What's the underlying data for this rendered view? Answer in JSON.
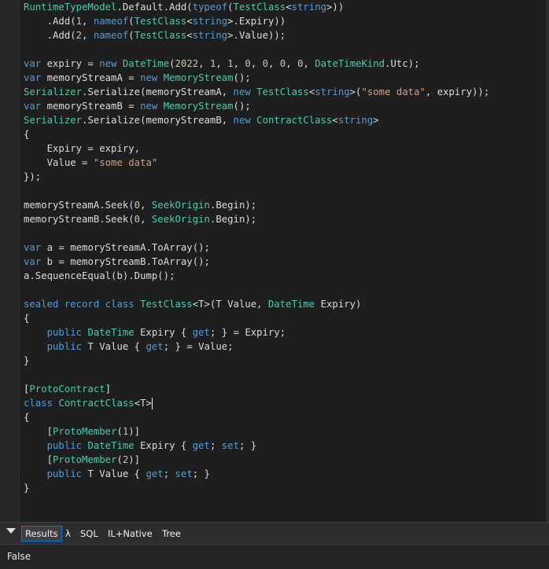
{
  "editor": {
    "lines": [
      [
        [
          "t",
          "RuntimeTypeModel"
        ],
        [
          "p",
          ".Default.Add("
        ],
        [
          "k",
          "typeof"
        ],
        [
          "p",
          "("
        ],
        [
          "t",
          "TestClass"
        ],
        [
          "p",
          "<"
        ],
        [
          "k",
          "string"
        ],
        [
          "p",
          ">))"
        ]
      ],
      [
        [
          "p",
          "    .Add("
        ],
        [
          "n",
          "1"
        ],
        [
          "p",
          ", "
        ],
        [
          "k",
          "nameof"
        ],
        [
          "p",
          "("
        ],
        [
          "t",
          "TestClass"
        ],
        [
          "p",
          "<"
        ],
        [
          "k",
          "string"
        ],
        [
          "p",
          ">.Expiry))"
        ]
      ],
      [
        [
          "p",
          "    .Add("
        ],
        [
          "n",
          "2"
        ],
        [
          "p",
          ", "
        ],
        [
          "k",
          "nameof"
        ],
        [
          "p",
          "("
        ],
        [
          "t",
          "TestClass"
        ],
        [
          "p",
          "<"
        ],
        [
          "k",
          "string"
        ],
        [
          "p",
          ">.Value));"
        ]
      ],
      [],
      [
        [
          "k",
          "var"
        ],
        [
          "p",
          " expiry = "
        ],
        [
          "k",
          "new"
        ],
        [
          "p",
          " "
        ],
        [
          "t",
          "DateTime"
        ],
        [
          "p",
          "("
        ],
        [
          "n",
          "2022"
        ],
        [
          "p",
          ", "
        ],
        [
          "n",
          "1"
        ],
        [
          "p",
          ", "
        ],
        [
          "n",
          "1"
        ],
        [
          "p",
          ", "
        ],
        [
          "n",
          "0"
        ],
        [
          "p",
          ", "
        ],
        [
          "n",
          "0"
        ],
        [
          "p",
          ", "
        ],
        [
          "n",
          "0"
        ],
        [
          "p",
          ", "
        ],
        [
          "n",
          "0"
        ],
        [
          "p",
          ", "
        ],
        [
          "t",
          "DateTimeKind"
        ],
        [
          "p",
          ".Utc);"
        ]
      ],
      [
        [
          "k",
          "var"
        ],
        [
          "p",
          " memoryStreamA = "
        ],
        [
          "k",
          "new"
        ],
        [
          "p",
          " "
        ],
        [
          "t",
          "MemoryStream"
        ],
        [
          "p",
          "();"
        ]
      ],
      [
        [
          "t",
          "Serializer"
        ],
        [
          "p",
          ".Serialize(memoryStreamA, "
        ],
        [
          "k",
          "new"
        ],
        [
          "p",
          " "
        ],
        [
          "t",
          "TestClass"
        ],
        [
          "p",
          "<"
        ],
        [
          "k",
          "string"
        ],
        [
          "p",
          ">("
        ],
        [
          "s",
          "\"some data\""
        ],
        [
          "p",
          ", expiry));"
        ]
      ],
      [
        [
          "k",
          "var"
        ],
        [
          "p",
          " memoryStreamB = "
        ],
        [
          "k",
          "new"
        ],
        [
          "p",
          " "
        ],
        [
          "t",
          "MemoryStream"
        ],
        [
          "p",
          "();"
        ]
      ],
      [
        [
          "t",
          "Serializer"
        ],
        [
          "p",
          ".Serialize(memoryStreamB, "
        ],
        [
          "k",
          "new"
        ],
        [
          "p",
          " "
        ],
        [
          "t",
          "ContractClass"
        ],
        [
          "p",
          "<"
        ],
        [
          "k",
          "string"
        ],
        [
          "p",
          ">"
        ]
      ],
      [
        [
          "p",
          "{"
        ]
      ],
      [
        [
          "p",
          "    Expiry = expiry,"
        ]
      ],
      [
        [
          "p",
          "    Value = "
        ],
        [
          "s",
          "\"some data\""
        ]
      ],
      [
        [
          "p",
          "});"
        ]
      ],
      [],
      [
        [
          "p",
          "memoryStreamA.Seek("
        ],
        [
          "n",
          "0"
        ],
        [
          "p",
          ", "
        ],
        [
          "t",
          "SeekOrigin"
        ],
        [
          "p",
          ".Begin);"
        ]
      ],
      [
        [
          "p",
          "memoryStreamB.Seek("
        ],
        [
          "n",
          "0"
        ],
        [
          "p",
          ", "
        ],
        [
          "t",
          "SeekOrigin"
        ],
        [
          "p",
          ".Begin);"
        ]
      ],
      [],
      [
        [
          "k",
          "var"
        ],
        [
          "p",
          " a = memoryStreamA.ToArray();"
        ]
      ],
      [
        [
          "k",
          "var"
        ],
        [
          "p",
          " b = memoryStreamB.ToArray();"
        ]
      ],
      [
        [
          "p",
          "a.SequenceEqual(b).Dump();"
        ]
      ],
      [],
      [
        [
          "k",
          "sealed record class"
        ],
        [
          "p",
          " "
        ],
        [
          "t",
          "TestClass"
        ],
        [
          "p",
          "<T>(T Value, "
        ],
        [
          "t",
          "DateTime"
        ],
        [
          "p",
          " Expiry)"
        ]
      ],
      [
        [
          "p",
          "{"
        ]
      ],
      [
        [
          "p",
          "    "
        ],
        [
          "k",
          "public"
        ],
        [
          "p",
          " "
        ],
        [
          "t",
          "DateTime"
        ],
        [
          "p",
          " Expiry { "
        ],
        [
          "k",
          "get"
        ],
        [
          "p",
          "; } = Expiry;"
        ]
      ],
      [
        [
          "p",
          "    "
        ],
        [
          "k",
          "public"
        ],
        [
          "p",
          " T Value { "
        ],
        [
          "k",
          "get"
        ],
        [
          "p",
          "; } = Value;"
        ]
      ],
      [
        [
          "p",
          "}"
        ]
      ],
      [],
      [
        [
          "p",
          "["
        ],
        [
          "t",
          "ProtoContract"
        ],
        [
          "p",
          "]"
        ]
      ],
      [
        [
          "k",
          "class"
        ],
        [
          "p",
          " "
        ],
        [
          "t",
          "ContractClass"
        ],
        [
          "p",
          "<T>"
        ],
        [
          "caret",
          ""
        ]
      ],
      [
        [
          "p",
          "{"
        ]
      ],
      [
        [
          "p",
          "    ["
        ],
        [
          "t",
          "ProtoMember"
        ],
        [
          "p",
          "("
        ],
        [
          "n",
          "1"
        ],
        [
          "p",
          ")]"
        ]
      ],
      [
        [
          "p",
          "    "
        ],
        [
          "k",
          "public"
        ],
        [
          "p",
          " "
        ],
        [
          "t",
          "DateTime"
        ],
        [
          "p",
          " Expiry { "
        ],
        [
          "k",
          "get"
        ],
        [
          "p",
          "; "
        ],
        [
          "k",
          "set"
        ],
        [
          "p",
          "; }"
        ]
      ],
      [
        [
          "p",
          "    ["
        ],
        [
          "t",
          "ProtoMember"
        ],
        [
          "p",
          "("
        ],
        [
          "n",
          "2"
        ],
        [
          "p",
          ")]"
        ]
      ],
      [
        [
          "p",
          "    "
        ],
        [
          "k",
          "public"
        ],
        [
          "p",
          " T Value { "
        ],
        [
          "k",
          "get"
        ],
        [
          "p",
          "; "
        ],
        [
          "k",
          "set"
        ],
        [
          "p",
          "; }"
        ]
      ],
      [
        [
          "p",
          "}"
        ]
      ]
    ]
  },
  "results_panel": {
    "tabs": [
      {
        "label": "Results",
        "active": true
      },
      {
        "label": "λ",
        "active": false
      },
      {
        "label": "SQL",
        "active": false
      },
      {
        "label": "IL+Native",
        "active": false
      },
      {
        "label": "Tree",
        "active": false
      }
    ],
    "output": "False"
  },
  "colors": {
    "type": "#4ec9b0",
    "keyword": "#569cd6",
    "string": "#d69d85",
    "number": "#b5cea8",
    "text": "#dcdcdc",
    "accent": "#007acc"
  }
}
